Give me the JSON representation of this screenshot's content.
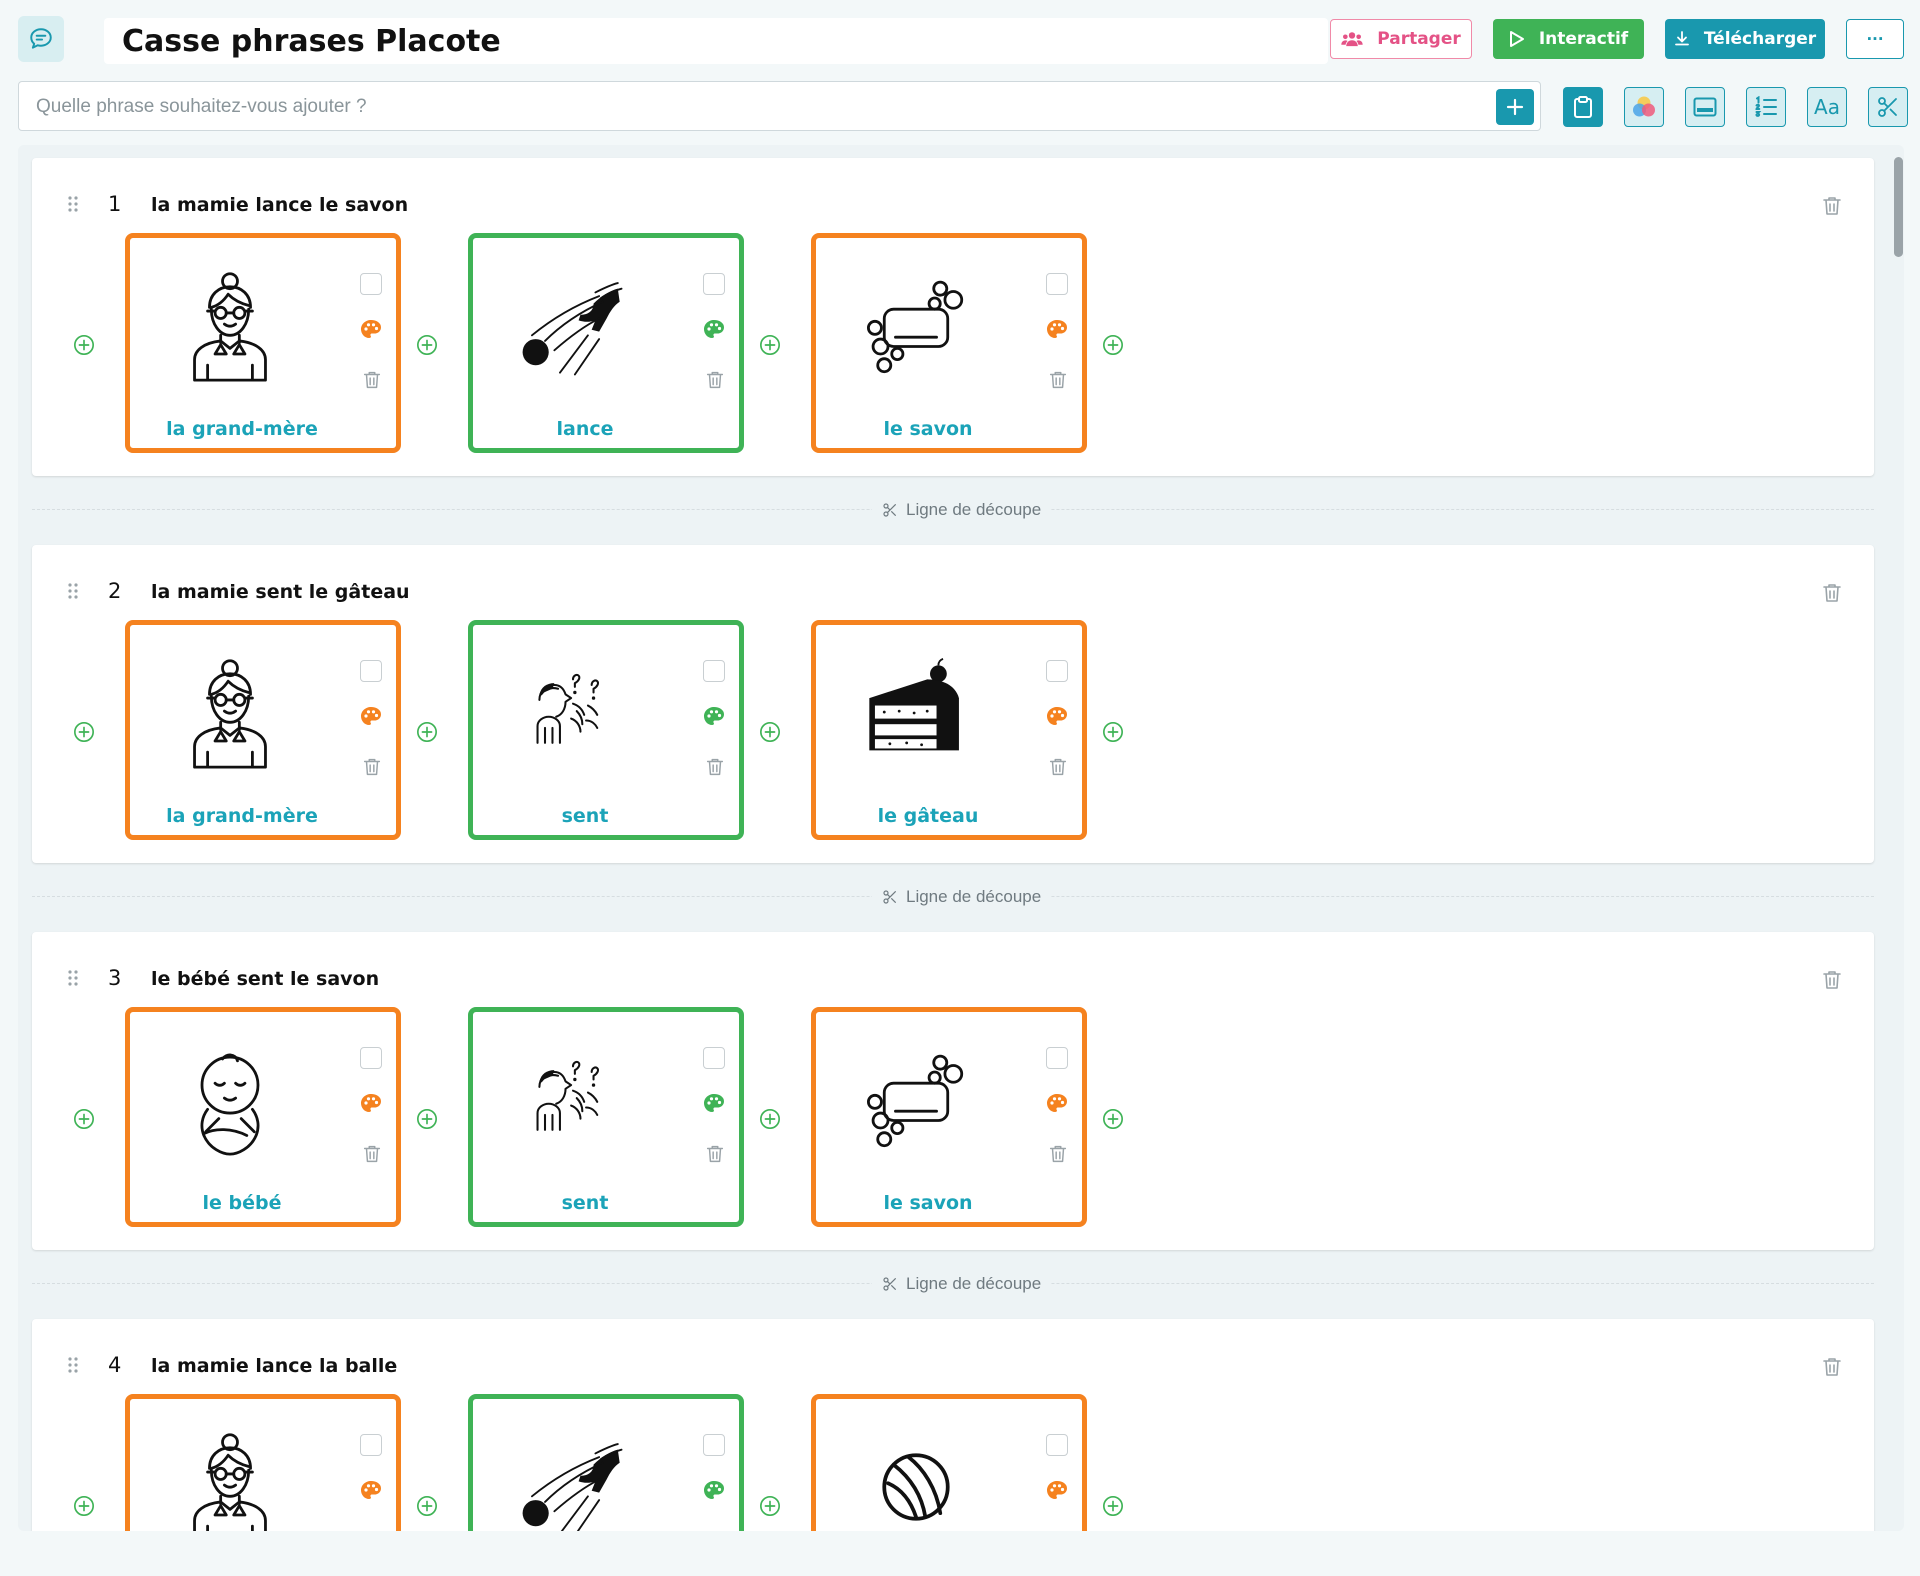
{
  "header": {
    "title": "Casse phrases Placote",
    "share_label": "Partager",
    "interactive_label": "Interactif",
    "download_label": "Télécharger",
    "more_label": "···"
  },
  "search": {
    "placeholder": "Quelle phrase souhaitez-vous ajouter ?",
    "value": ""
  },
  "toolbar": {
    "icons": [
      "clipboard-icon",
      "color-circles-icon",
      "layout-icon",
      "numbered-list-icon",
      "font-icon",
      "scissors-icon"
    ],
    "font_label": "Aa"
  },
  "cut_line_label": "Ligne de découpe",
  "colors": {
    "accent": "#1998ae",
    "noun": "#f5821f",
    "verb": "#3fb356",
    "share": "#e45286"
  },
  "sentences": [
    {
      "number": "1",
      "text": "la mamie lance le savon",
      "cards": [
        {
          "word": "la grand-mère",
          "image": "grandmother-icon",
          "role": "noun"
        },
        {
          "word": "lance",
          "image": "throw-icon",
          "role": "verb"
        },
        {
          "word": "le savon",
          "image": "soap-icon",
          "role": "noun"
        }
      ]
    },
    {
      "number": "2",
      "text": "la mamie sent le gâteau",
      "cards": [
        {
          "word": "la grand-mère",
          "image": "grandmother-icon",
          "role": "noun"
        },
        {
          "word": "sent",
          "image": "smell-icon",
          "role": "verb"
        },
        {
          "word": "le gâteau",
          "image": "cake-icon",
          "role": "noun"
        }
      ]
    },
    {
      "number": "3",
      "text": "le bébé sent le savon",
      "cards": [
        {
          "word": "le bébé",
          "image": "baby-icon",
          "role": "noun"
        },
        {
          "word": "sent",
          "image": "smell-icon",
          "role": "verb"
        },
        {
          "word": "le savon",
          "image": "soap-icon",
          "role": "noun"
        }
      ]
    },
    {
      "number": "4",
      "text": "la mamie lance la balle",
      "cards": [
        {
          "word": "",
          "image": "grandmother-icon",
          "role": "noun"
        },
        {
          "word": "",
          "image": "throw-icon",
          "role": "verb"
        },
        {
          "word": "",
          "image": "ball-icon",
          "role": "noun"
        }
      ]
    }
  ]
}
